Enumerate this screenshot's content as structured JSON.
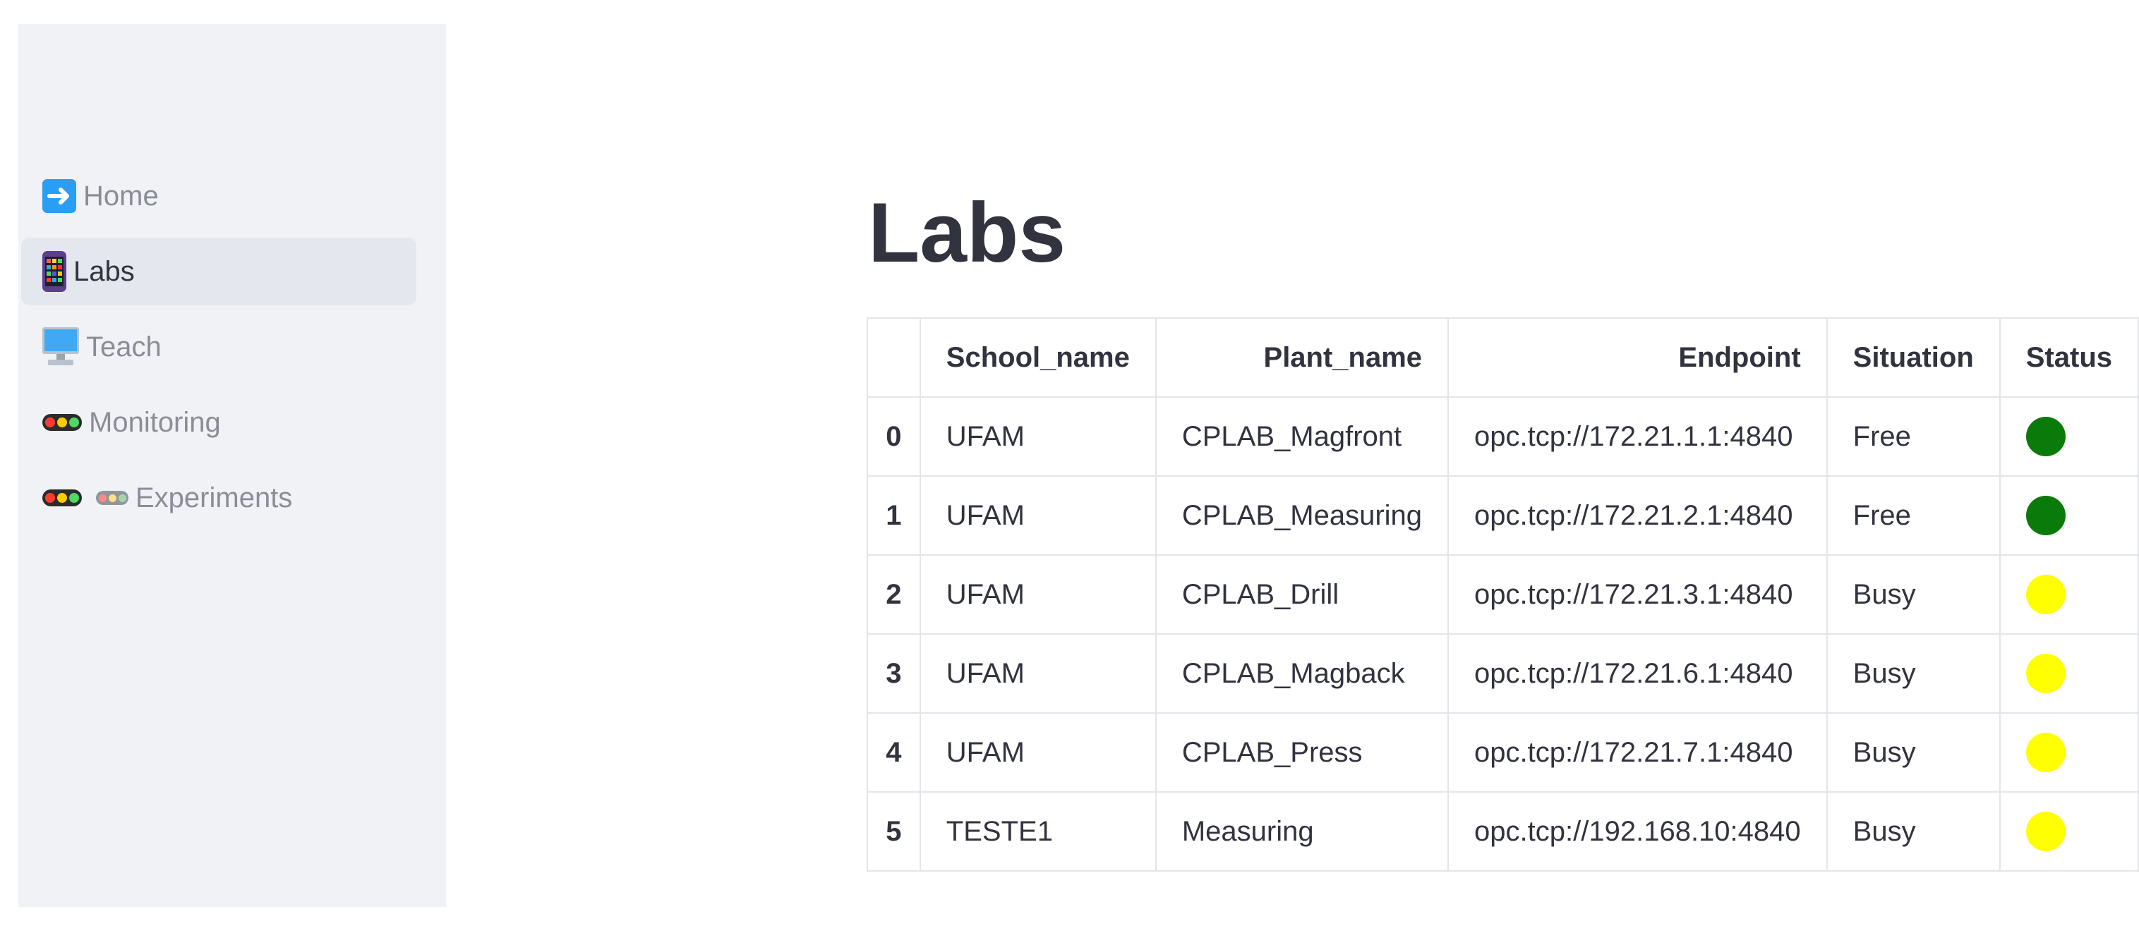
{
  "sidebar": {
    "items": [
      {
        "label": "Home",
        "icon": "arrow-right-icon",
        "active": false
      },
      {
        "label": "Labs",
        "icon": "mobile-phone-icon",
        "active": true
      },
      {
        "label": "Teach",
        "icon": "desktop-monitor-icon",
        "active": false
      },
      {
        "label": "Monitoring",
        "icon": "traffic-light-icon",
        "active": false
      },
      {
        "label": "Experiments",
        "icon": "traffic-light-icon",
        "active": false
      }
    ]
  },
  "main": {
    "title": "Labs",
    "table": {
      "columns": [
        "",
        "School_name",
        "Plant_name",
        "Endpoint",
        "Situation",
        "Status"
      ],
      "rows": [
        {
          "index": "0",
          "school_name": "UFAM",
          "plant_name": "CPLAB_Magfront",
          "endpoint": "opc.tcp://172.21.1.1:4840",
          "situation": "Free",
          "status_color": "#0a7a0a"
        },
        {
          "index": "1",
          "school_name": "UFAM",
          "plant_name": "CPLAB_Measuring",
          "endpoint": "opc.tcp://172.21.2.1:4840",
          "situation": "Free",
          "status_color": "#0a7a0a"
        },
        {
          "index": "2",
          "school_name": "UFAM",
          "plant_name": "CPLAB_Drill",
          "endpoint": "opc.tcp://172.21.3.1:4840",
          "situation": "Busy",
          "status_color": "#ffff00"
        },
        {
          "index": "3",
          "school_name": "UFAM",
          "plant_name": "CPLAB_Magback",
          "endpoint": "opc.tcp://172.21.6.1:4840",
          "situation": "Busy",
          "status_color": "#ffff00"
        },
        {
          "index": "4",
          "school_name": "UFAM",
          "plant_name": "CPLAB_Press",
          "endpoint": "opc.tcp://172.21.7.1:4840",
          "situation": "Busy",
          "status_color": "#ffff00"
        },
        {
          "index": "5",
          "school_name": "TESTE1",
          "plant_name": "Measuring",
          "endpoint": "opc.tcp://192.168.10:4840",
          "situation": "Busy",
          "status_color": "#ffff00"
        }
      ]
    }
  },
  "colors": {
    "sidebar_bg": "#f0f2f6",
    "active_item_bg": "#e4e7ee",
    "free_status": "#0a7a0a",
    "busy_status": "#ffff00",
    "text": "#31333f"
  }
}
